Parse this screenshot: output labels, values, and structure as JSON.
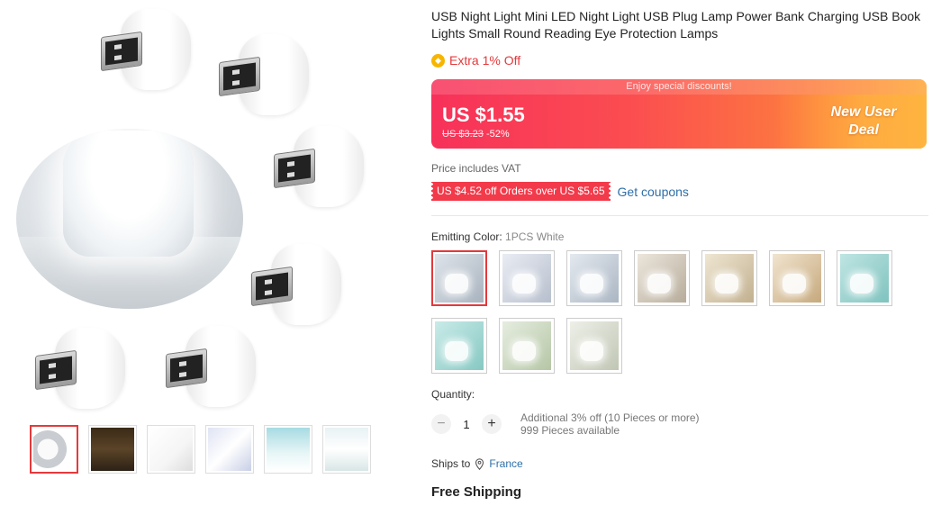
{
  "product": {
    "title": "USB Night Light Mini LED Night Light USB Plug Lamp Power Bank Charging USB Book Lights Small Round Reading Eye Protection Lamps",
    "extra_discount": "Extra 1% Off",
    "extra_badge_icon": "coin-icon"
  },
  "price_banner": {
    "strip_text": "Enjoy special discounts!",
    "current_price": "US $1.55",
    "original_price": "US $3.23",
    "discount_percent": "-52%",
    "deal_label_line1": "New User",
    "deal_label_line2": "Deal",
    "gradient_start": "#f7315a",
    "gradient_end": "#ffa534"
  },
  "vat_note": "Price includes VAT",
  "coupon": {
    "text": "US $4.52 off Orders over US $5.65",
    "link": "Get coupons"
  },
  "color": {
    "label": "Emitting Color:",
    "selected_value": "1PCS White",
    "option_count": 10,
    "selected_index": 0
  },
  "quantity": {
    "label": "Quantity:",
    "value": "1",
    "minus": "−",
    "plus": "+",
    "additional_offer": "Additional 3% off (10 Pieces or more)",
    "available": "999 Pieces available"
  },
  "shipping": {
    "ships_to_label": "Ships to",
    "destination": "France",
    "free_shipping": "Free Shipping"
  },
  "gallery": {
    "thumbnail_count": 6,
    "active_thumbnail": 0
  },
  "colors": {
    "accent_red": "#e4393c",
    "link_blue": "#2e6fa8"
  }
}
